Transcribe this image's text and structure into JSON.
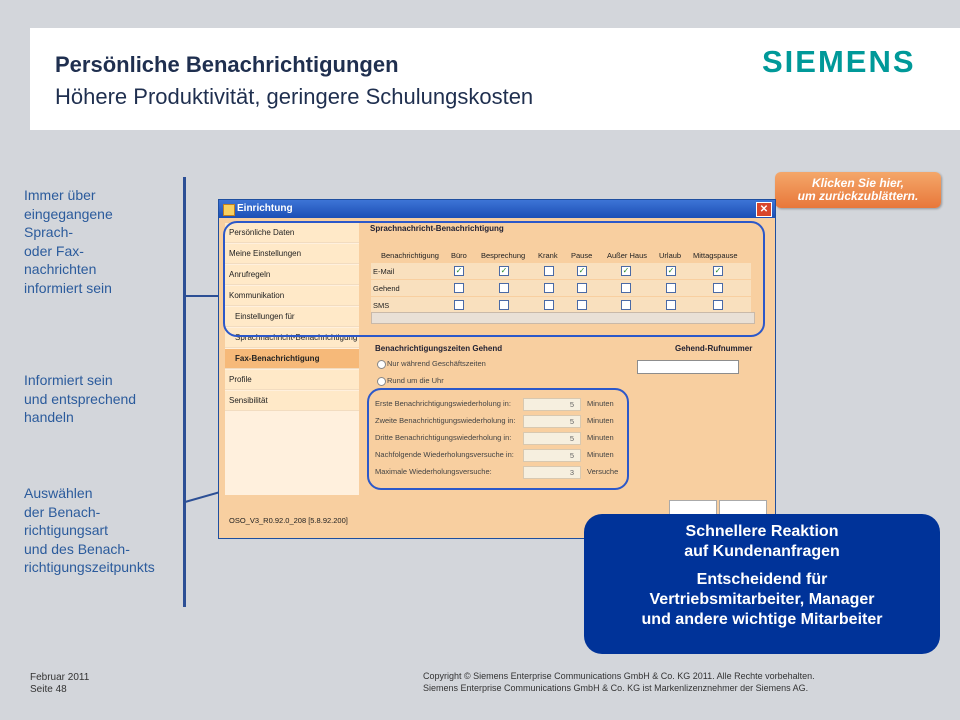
{
  "header": {
    "title": "Persönliche Benachrichtigungen",
    "subtitle": "Höhere Produktivität, geringere Schulungskosten",
    "logo_text": "SIEMENS"
  },
  "sidebar_text": [
    "Immer über\neingegangene\nSprach-\noder Fax-\nnachrichten\ninformiert sein",
    "Informiert sein\nund entsprechend\nhandeln",
    "Auswählen\nder Benach-\nrichtigungsart\nund des Benach-\nrichtigungszeitpunkts"
  ],
  "back_button": {
    "line1": "Klicken Sie hier,",
    "line2": "um zurückzublättern."
  },
  "window": {
    "title": "Einrichtung",
    "close_glyph": "✕",
    "status": "OSO_V3_R0.92.0_208 [5.8.92.200]",
    "nav": [
      "Persönliche Daten",
      "Meine Einstellungen",
      "Anrufregeln",
      "Kommunikation",
      "Einstellungen für Sprachnachrichten",
      "Sprachnachricht-Benachrichtigung",
      "Fax-Benachrichtigung",
      "Profile",
      "Sensibilität"
    ],
    "voice_section": {
      "title": "Sprachnachricht-Benachrichtigung",
      "columns": [
        "Benachrichtigung",
        "Büro",
        "Besprechung",
        "Krank",
        "Pause",
        "Außer Haus",
        "Urlaub",
        "Mittagspause"
      ],
      "rows": [
        {
          "label": "E-Mail",
          "checks": [
            true,
            true,
            false,
            true,
            true,
            true,
            true
          ]
        },
        {
          "label": "Gehend",
          "checks": [
            false,
            false,
            false,
            false,
            false,
            false,
            false
          ]
        },
        {
          "label": "SMS",
          "checks": [
            false,
            false,
            false,
            false,
            false,
            false,
            false
          ]
        }
      ]
    },
    "times_section": {
      "title": "Benachrichtigungszeiten Gehend",
      "number_label": "Gehend-Rufnummer",
      "radio1": "Nur während Geschäftszeiten",
      "radio2": "Rund um die Uhr",
      "fields": [
        {
          "label": "Erste Benachrichtigungswiederholung in:",
          "value": "5",
          "unit": "Minuten"
        },
        {
          "label": "Zweite Benachrichtigungswiederholung in:",
          "value": "5",
          "unit": "Minuten"
        },
        {
          "label": "Dritte Benachrichtigungswiederholung in:",
          "value": "5",
          "unit": "Minuten"
        },
        {
          "label": "Nachfolgende Wiederholungsversuche in:",
          "value": "5",
          "unit": "Minuten"
        },
        {
          "label": "Maximale Wiederholungsversuche:",
          "value": "3",
          "unit": "Versuche"
        }
      ]
    }
  },
  "callout": {
    "line1": "Schnellere Reaktion",
    "line2": "auf Kundenanfragen",
    "line3": "Entscheidend für",
    "line4": "Vertriebsmitarbeiter, Manager",
    "line5": "und andere wichtige Mitarbeiter"
  },
  "footer": {
    "date": "Februar 2011",
    "page": "Seite 48",
    "copyright1": "Copyright © Siemens Enterprise Communications GmbH & Co. KG 2011. Alle Rechte vorbehalten.",
    "copyright2": "Siemens Enterprise Communications GmbH & Co. KG ist Markenlizenznehmer der Siemens AG."
  },
  "colors": {
    "accent": "#003399",
    "logo": "#009999",
    "text_blue": "#2b5b9c",
    "orange": "#e8773a"
  }
}
